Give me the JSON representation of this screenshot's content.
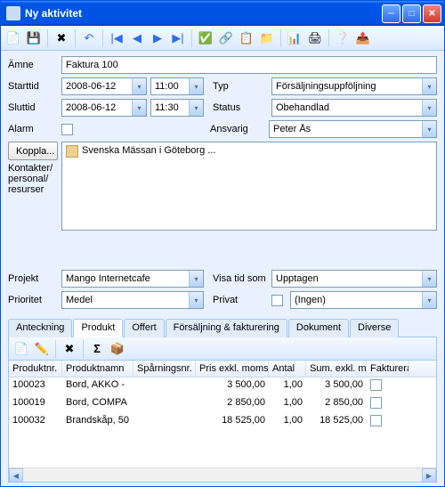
{
  "window": {
    "title": "Ny aktivitet"
  },
  "labels": {
    "amne": "Ämne",
    "starttid": "Starttid",
    "sluttid": "Sluttid",
    "typ": "Typ",
    "status": "Status",
    "alarm": "Alarm",
    "ansvarig": "Ansvarig",
    "koppla": "Koppla...",
    "kontakter": "Kontakter/\npersonal/\nresurser",
    "projekt": "Projekt",
    "visa_tid_som": "Visa tid som",
    "prioritet": "Prioritet",
    "privat": "Privat"
  },
  "subject": "Faktura 100",
  "start": {
    "date": "2008-06-12",
    "time": "11:00"
  },
  "end": {
    "date": "2008-06-12",
    "time": "11:30"
  },
  "typ": "Försäljningsuppföljning",
  "status": "Obehandlad",
  "ansvarig": "Peter Ås",
  "linked_text": "Svenska Mässan i Göteborg ...",
  "projekt": "Mango Internetcafe",
  "visa_tid_som": "Upptagen",
  "prioritet": "Medel",
  "privat_group": "(Ingen)",
  "tabs": [
    "Anteckning",
    "Produkt",
    "Offert",
    "Försäljning & fakturering",
    "Dokument",
    "Diverse"
  ],
  "active_tab": 1,
  "grid": {
    "columns": [
      "Produktnr.",
      "Produktnamn",
      "Spårningsnr.",
      "Pris exkl. moms",
      "Antal",
      "Sum. exkl. moms",
      "Fakturerat"
    ],
    "rows": [
      {
        "pn": "100023",
        "name": "Bord, AKKO -",
        "sp": "",
        "pris": "3 500,00",
        "antal": "1,00",
        "sum": "3 500,00"
      },
      {
        "pn": "100019",
        "name": "Bord, COMPA",
        "sp": "",
        "pris": "2 850,00",
        "antal": "1,00",
        "sum": "2 850,00"
      },
      {
        "pn": "100032",
        "name": "Brandskåp, 50",
        "sp": "",
        "pris": "18 525,00",
        "antal": "1,00",
        "sum": "18 525,00"
      }
    ]
  }
}
